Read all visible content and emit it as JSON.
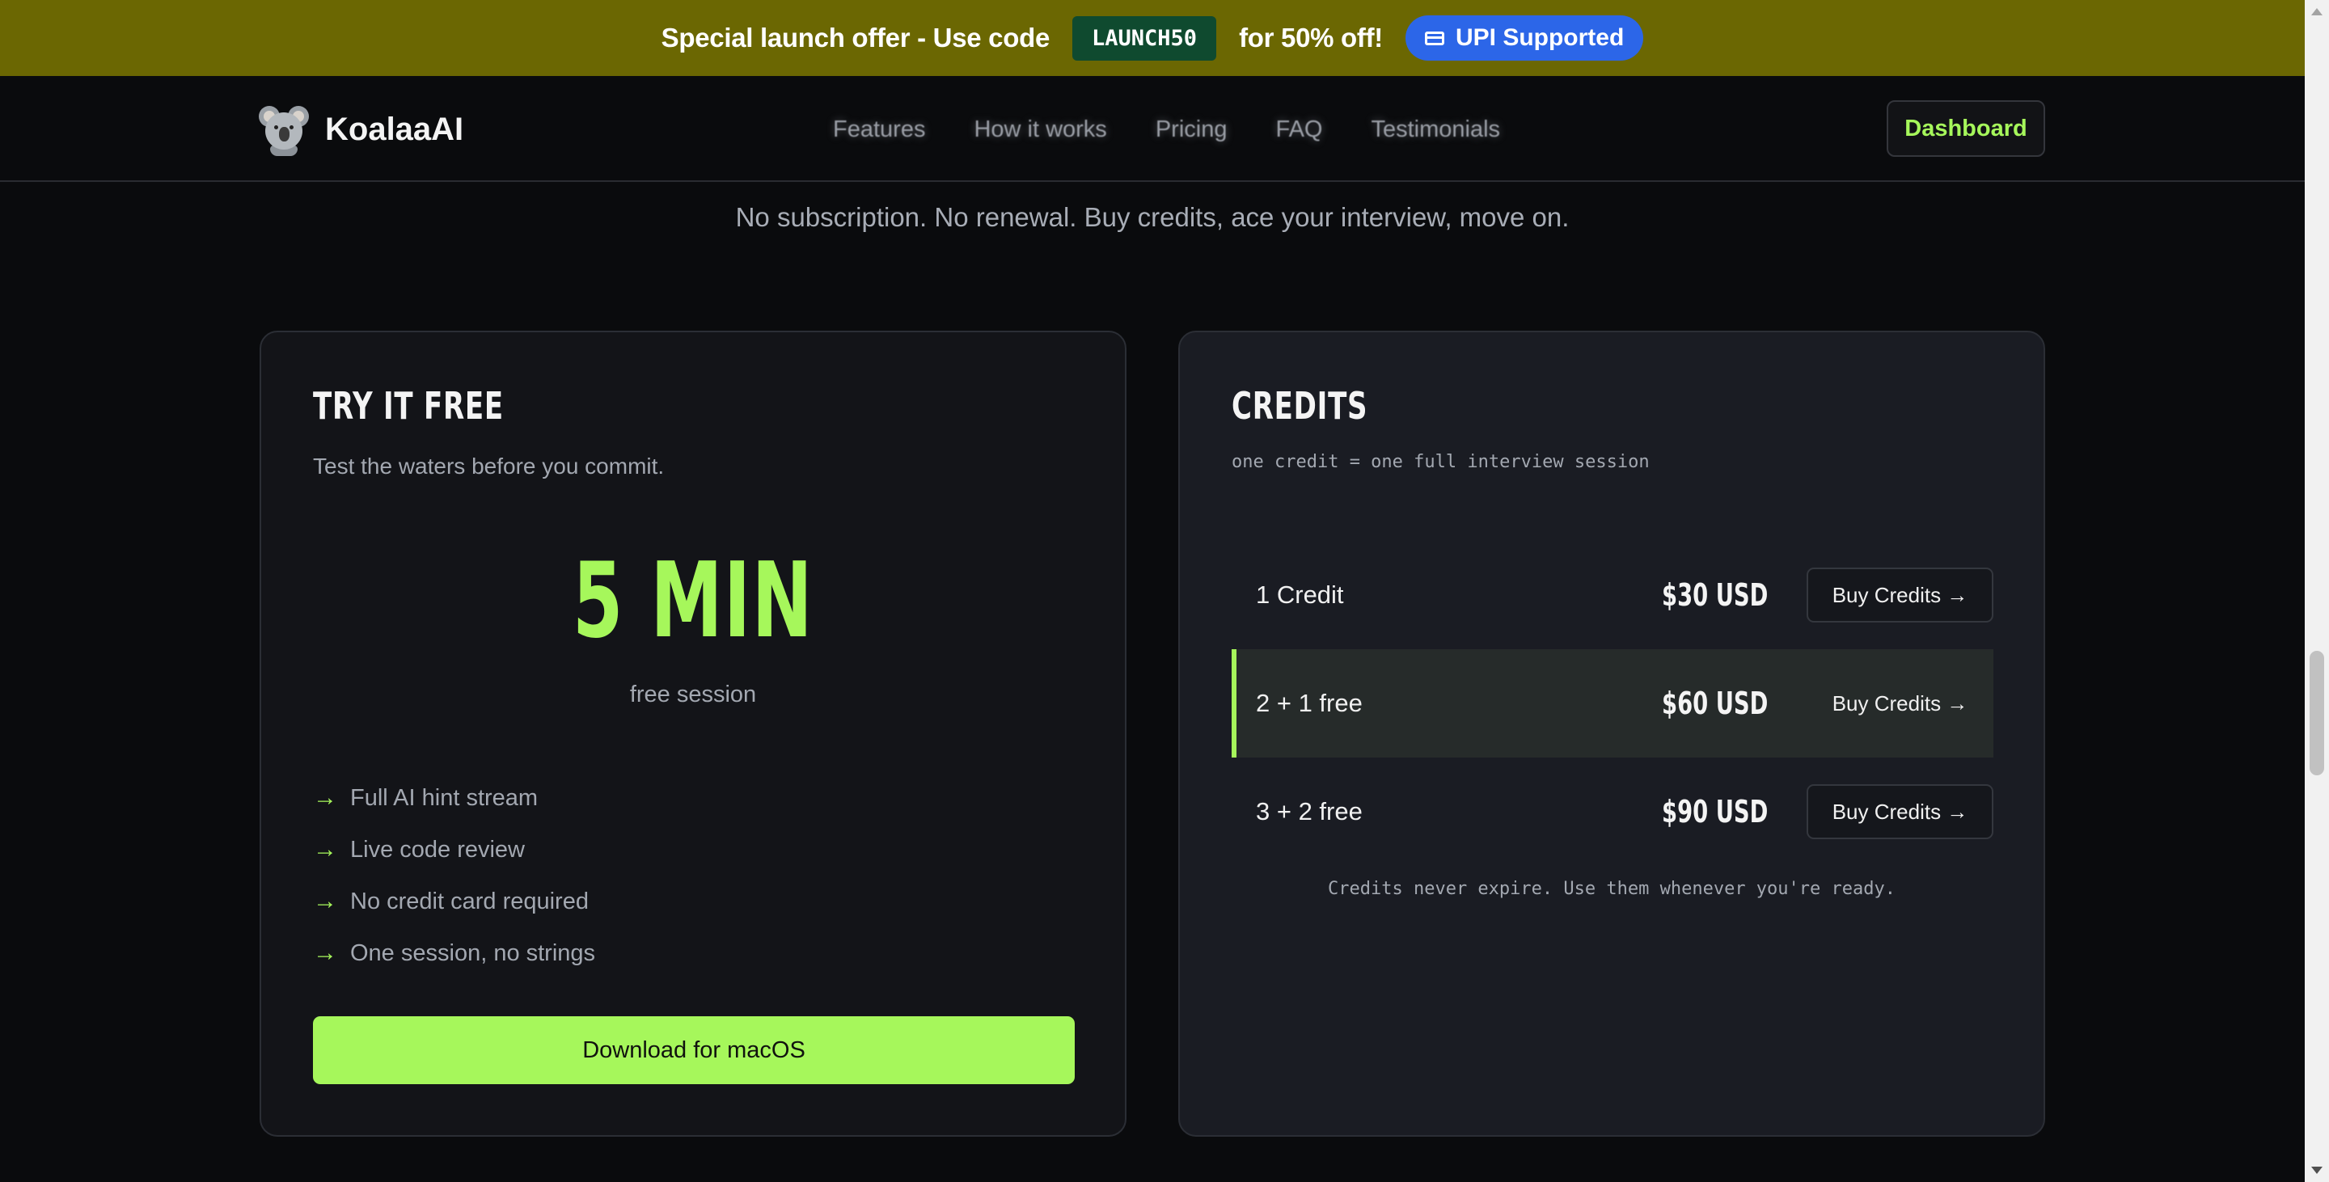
{
  "promo": {
    "text_before": "Special launch offer - Use code",
    "code": "LAUNCH50",
    "text_after": "for 50% off!",
    "badge_label": "UPI Supported",
    "badge_icon": "credit-card-icon",
    "background_color": "#6b6702"
  },
  "nav": {
    "brand": "KoalaaAI",
    "logo_icon": "koala-icon",
    "links": [
      "Features",
      "How it works",
      "Pricing",
      "FAQ",
      "Testimonials"
    ],
    "dashboard_label": "Dashboard"
  },
  "pricing": {
    "subtitle": "No subscription. No renewal. Buy credits, ace your interview, move on.",
    "free": {
      "title": "TRY IT FREE",
      "description": "Test the waters before you commit.",
      "amount": "5 MIN",
      "amount_caption": "free session",
      "features": [
        "Full AI hint stream",
        "Live code review",
        "No credit card required",
        "One session, no strings"
      ],
      "feature_icon": "arrow-right-icon",
      "cta_label": "Download for macOS"
    },
    "credits": {
      "title": "CREDITS",
      "note": "one credit = one full interview session",
      "tiers": [
        {
          "name": "1 Credit",
          "price": "$30 USD",
          "button": "Buy Credits →"
        },
        {
          "name": "2 + 1 free",
          "price": "$60 USD",
          "button": "Buy Credits →"
        },
        {
          "name": "3 + 2 free",
          "price": "$90 USD",
          "button": "Buy Credits →"
        }
      ],
      "highlighted_tier": 1,
      "footnote": "Credits never expire. Use them whenever you're ready."
    }
  },
  "colors": {
    "accent": "#a6f75b",
    "background": "#0a0b0d",
    "badge_blue": "#2c66e8",
    "code_green": "#0f4a2f"
  }
}
